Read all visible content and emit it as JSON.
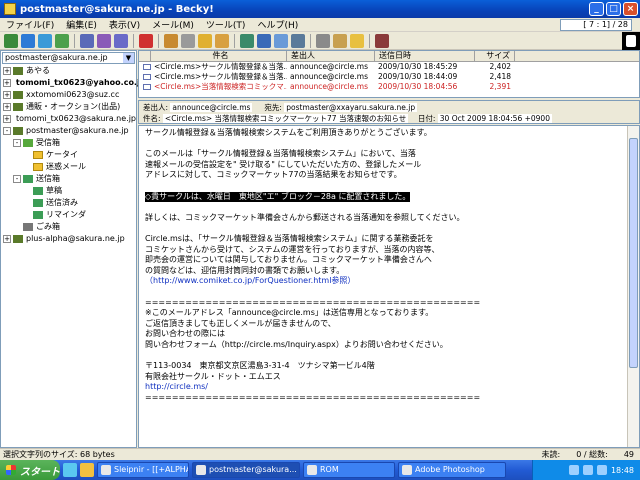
{
  "window": {
    "title": "postmaster@sakura.ne.jp - Becky!"
  },
  "menu": {
    "items": [
      "ファイル(F)",
      "編集(E)",
      "表示(V)",
      "メール(M)",
      "ツール(T)",
      "ヘルプ(H)"
    ],
    "counter": "[ 7 : 1] / 28"
  },
  "folders": {
    "account_select": "postmaster@sakura.ne.jp",
    "tree": [
      {
        "label": "あやる",
        "type": "acct",
        "indent": 0,
        "pm": "+"
      },
      {
        "label": "tomomi_tx0623@yahoo.co.jp",
        "type": "acct",
        "indent": 0,
        "pm": "+",
        "bold": true
      },
      {
        "label": "xxtomomi0623@suz.cc",
        "type": "acct",
        "indent": 0,
        "pm": "+"
      },
      {
        "label": "通販・オークション(出品)",
        "type": "acct",
        "indent": 0,
        "pm": "+"
      },
      {
        "label": "tomomi_tx0623@sakura.ne.jp",
        "type": "acct",
        "indent": 0,
        "pm": "+"
      },
      {
        "label": "postmaster@sakura.ne.jp",
        "type": "acct",
        "indent": 0,
        "pm": "-"
      },
      {
        "label": "受信箱",
        "type": "inbox",
        "indent": 1,
        "pm": "-"
      },
      {
        "label": "ケータイ",
        "type": "fol",
        "indent": 2,
        "pm": ""
      },
      {
        "label": "迷惑メール",
        "type": "fol",
        "indent": 2,
        "pm": ""
      },
      {
        "label": "送信箱",
        "type": "sent",
        "indent": 1,
        "pm": "-"
      },
      {
        "label": "草稿",
        "type": "sent",
        "indent": 2,
        "pm": ""
      },
      {
        "label": "送信済み",
        "type": "sent",
        "indent": 2,
        "pm": ""
      },
      {
        "label": "リマインダ",
        "type": "sent",
        "indent": 2,
        "pm": ""
      },
      {
        "label": "ごみ箱",
        "type": "trash",
        "indent": 1,
        "pm": ""
      },
      {
        "label": "plus-alpha@sakura.ne.jp",
        "type": "acct",
        "indent": 0,
        "pm": "+"
      }
    ]
  },
  "list": {
    "headers": {
      "subject": "件名",
      "from": "差出人",
      "date": "送信日時",
      "size": "サイズ"
    },
    "rows": [
      {
        "subject": "<Circle.ms>サークル情報登録＆当落...",
        "from": "announce@circle.ms",
        "date": "2009/10/30 18:45:29",
        "size": "2,402",
        "selected": false
      },
      {
        "subject": "<Circle.ms>サークル情報登録＆当落...",
        "from": "announce@circle.ms",
        "date": "2009/10/30 18:44:09",
        "size": "2,418",
        "selected": false
      },
      {
        "subject": "<Circle.ms>当落情報検索コミックマ...",
        "from": "announce@circle.ms",
        "date": "2009/10/30 18:04:56",
        "size": "2,391",
        "selected": true
      }
    ]
  },
  "header": {
    "from_label": "差出人:",
    "from": "announce@circle.ms",
    "to_label": "宛先:",
    "to": "postmaster@xxayaru.sakura.ne.jp",
    "subject_label": "件名:",
    "subject": "<Circle.ms> 当落情報検索コミックマーケット77 当落速報のお知らせ",
    "date_label": "日付:",
    "date": "30 Oct 2009 18:04:56 +0900"
  },
  "body": {
    "lines": [
      {
        "text": "サークル情報登録＆当落情報検索システムをご利用頂きありがとうございます。"
      },
      {
        "text": ""
      },
      {
        "text": "このメールは「サークル情報登録＆当落情報検索システム」において、当落"
      },
      {
        "text": "速報メールの受信設定を\" 受け取る\" にしていただいた方の、登録したメール"
      },
      {
        "text": "アドレスに対して、コミックマーケット77の当落結果をお知らせです。"
      },
      {
        "text": ""
      },
      {
        "text": "◇貴サークルは、水曜日　東地区\"エ\" ブロック－28a に配置されました。",
        "highlight": true
      },
      {
        "text": ""
      },
      {
        "text": "詳しくは、コミックマーケット準備会さんから郵送される当落通知を参照してください。"
      },
      {
        "text": ""
      },
      {
        "text": "Circle.msは、「サークル情報登録＆当落情報検索システム」に関する業務委託を"
      },
      {
        "text": "コミケットさんから受けて、システムの運営を行っておりますが、当落の内容等、"
      },
      {
        "text": "即売会の運営については関与しておりません。コミックマーケット準備会さんへ"
      },
      {
        "text": "の質問などは、迎信用封筒同封の書類でお願いします。"
      },
      {
        "text": "（http://www.comiket.co.jp/ForQuestioner.html参照）",
        "link": true
      },
      {
        "text": ""
      },
      {
        "text": "=================================================="
      },
      {
        "text": "※このメールアドレス「announce@circle.ms」は送信専用となっております。"
      },
      {
        "text": "ご返信頂きましても正しくメールが届きませんので、"
      },
      {
        "text": "お問い合わせの際には"
      },
      {
        "text": "問い合わせフォーム（http://circle.ms/Inquiry.aspx）よりお問い合わせください。"
      },
      {
        "text": ""
      },
      {
        "text": "〒113-0034　東京都文京区湯島3-31-4　ツナシマ第一ビル4階"
      },
      {
        "text": "有限会社サークル・ドット・エムエス"
      },
      {
        "text": "http://circle.ms/",
        "link": true
      },
      {
        "text": "=================================================="
      }
    ]
  },
  "status": {
    "left": "選択文字列のサイズ: 68 bytes",
    "unread": "未読:",
    "count": "0 / 総数:",
    "total": "49"
  },
  "taskbar": {
    "start": "スタート",
    "tasks": [
      "Sleipnir - [[+ALPHA...",
      "postmaster@sakura...",
      "ROM",
      "Adobe Photoshop"
    ],
    "active_index": 1,
    "time": "18:48"
  }
}
